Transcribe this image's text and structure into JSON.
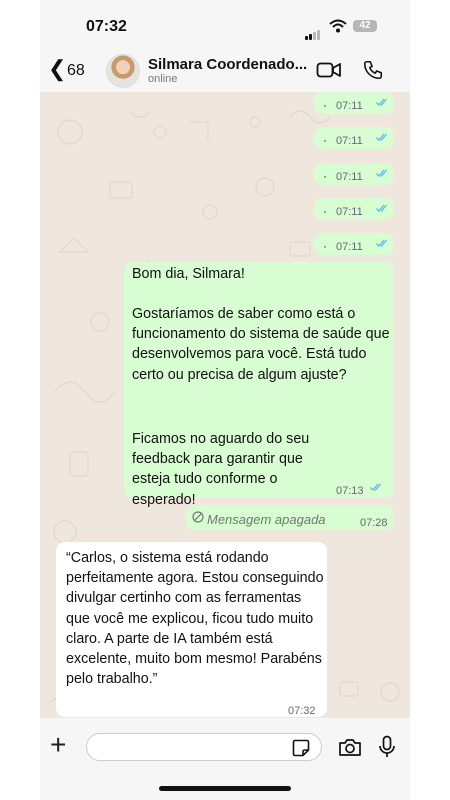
{
  "status_bar": {
    "time": "07:32",
    "battery": "42"
  },
  "header": {
    "back_count": "68",
    "contact_name": "Silmara Coordenado...",
    "contact_status": "online"
  },
  "messages": {
    "dots": [
      {
        "text": "·",
        "time": "07:11"
      },
      {
        "text": "·",
        "time": "07:11"
      },
      {
        "text": "·",
        "time": "07:11"
      },
      {
        "text": "·",
        "time": "07:11"
      },
      {
        "text": "·",
        "time": "07:11"
      }
    ],
    "long_outgoing": {
      "greeting": "Bom dia, Silmara!",
      "body": "Gostaríamos de saber como está o funcionamento do sistema de saúde que desenvolvemos para você. Está tudo certo ou precisa de algum ajuste?",
      "closing": "Ficamos no aguardo do seu feedback para garantir que esteja tudo conforme o esperado!",
      "time": "07:13"
    },
    "deleted": {
      "text": "Mensagem apagada",
      "time": "07:28"
    },
    "incoming": {
      "text": "“Carlos, o sistema está rodando perfeitamente agora. Estou conseguindo divulgar certinho com as ferramentas que você me explicou, ficou tudo muito claro. A parte de IA também está excelente, muito bom mesmo! Parabéns pelo trabalho.”",
      "time": "07:32"
    }
  },
  "composer": {
    "input_value": ""
  },
  "colors": {
    "chat_background": "#efe7de",
    "outgoing_bubble": "#d9fdd3",
    "incoming_bubble": "#ffffff",
    "read_ticks": "#53bdeb"
  }
}
